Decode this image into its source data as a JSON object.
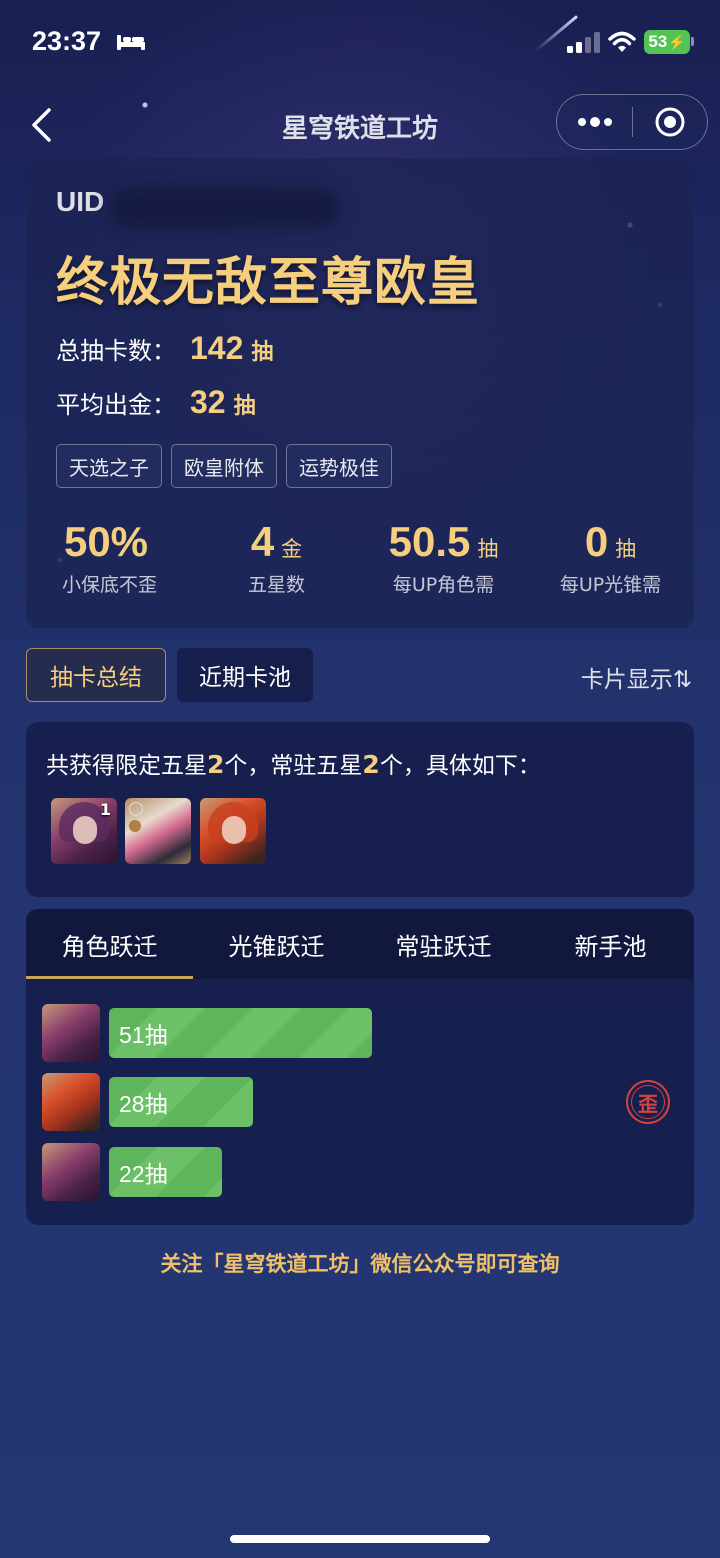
{
  "status_bar": {
    "time": "23:37",
    "battery": "53"
  },
  "nav": {
    "title": "星穹铁道工坊"
  },
  "profile": {
    "uid_label": "UID",
    "rank_title": "终极无敌至尊欧皇",
    "total_pulls_label": "总抽卡数：",
    "total_pulls_value": "142",
    "total_pulls_unit": "抽",
    "avg_gold_label": "平均出金：",
    "avg_gold_value": "32",
    "avg_gold_unit": "抽",
    "tags": [
      "天选之子",
      "欧皇附体",
      "运势极佳"
    ]
  },
  "metrics": [
    {
      "value": "50%",
      "unit": "",
      "label": "小保底不歪"
    },
    {
      "value": "4",
      "unit": "金",
      "label": "五星数"
    },
    {
      "value": "50.5",
      "unit": "抽",
      "label": "每UP角色需"
    },
    {
      "value": "0",
      "unit": "抽",
      "label": "每UP光锥需"
    }
  ],
  "tabs": {
    "summary": "抽卡总结",
    "recent": "近期卡池",
    "card_display": "卡片显示⇅"
  },
  "obtained": {
    "prefix": "共获得限定五星",
    "limited_count": "2",
    "mid": "个，常驻五星",
    "standard_count": "2",
    "suffix": "个，具体如下：",
    "first_badge": "1"
  },
  "jump_tabs": [
    "角色跃迁",
    "光锥跃迁",
    "常驻跃迁",
    "新手池"
  ],
  "pull_rows": [
    {
      "label": "51抽",
      "pulls": 51
    },
    {
      "label": "28抽",
      "pulls": 28
    },
    {
      "label": "22抽",
      "pulls": 22
    }
  ],
  "stamp": "歪",
  "footer": "关注「星穹铁道工坊」微信公众号即可查询",
  "colors": {
    "gold": "#f5cf7e",
    "bar_green": "#5fb55b",
    "stamp_red": "#d9413e"
  }
}
